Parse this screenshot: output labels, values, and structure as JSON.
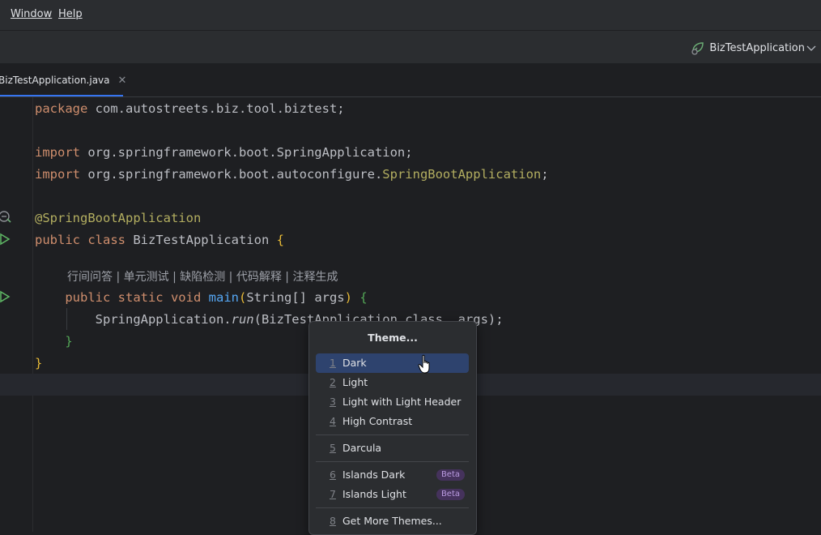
{
  "menubar": {
    "items": [
      "Window",
      "Help"
    ]
  },
  "toolbar": {
    "run_config": "BizTestApplication"
  },
  "tabs": [
    {
      "label": "BizTestApplication.java"
    }
  ],
  "code": {
    "package_kw": "package",
    "package_name": " com.autostreets.biz.tool.biztest;",
    "import_kw": "import",
    "import1": " org.springframework.boot.SpringApplication;",
    "import2_prefix": " org.springframework.boot.autoconfigure.",
    "import2_class": "SpringBootApplication",
    "semicolon": ";",
    "annotation": "@SpringBootApplication",
    "public_class_kw": "public class",
    "class_name": " BizTestApplication ",
    "brace_open": "{",
    "brace_close": "}",
    "inlay_hint": "行间问答 | 单元测试 | 缺陷检测 | 代码解释 | 注释生成",
    "method_kw": "public static void",
    "method_name": "main",
    "method_paren_open": "(",
    "method_params": "String[] args",
    "method_paren_close": ")",
    "call_class": "SpringApplication.",
    "call_method": "run",
    "call_args": "(BizTestApplication.class, args);"
  },
  "theme_popup": {
    "title": "Theme...",
    "items": [
      {
        "num": "1",
        "label": "Dark",
        "selected": true
      },
      {
        "num": "2",
        "label": "Light"
      },
      {
        "num": "3",
        "label": "Light with Light Header"
      },
      {
        "num": "4",
        "label": "High Contrast"
      },
      {
        "num": "5",
        "label": "Darcula"
      },
      {
        "num": "6",
        "label": "Islands Dark",
        "badge": "Beta"
      },
      {
        "num": "7",
        "label": "Islands Light",
        "badge": "Beta"
      },
      {
        "num": "8",
        "label": "Get More Themes..."
      }
    ]
  },
  "colors": {
    "accent": "#3574f0",
    "selection": "#2e436e",
    "keyword": "#cf8e6d",
    "annotation": "#b3ae60",
    "function": "#56a8f5",
    "beta_badge": "#45325c"
  }
}
